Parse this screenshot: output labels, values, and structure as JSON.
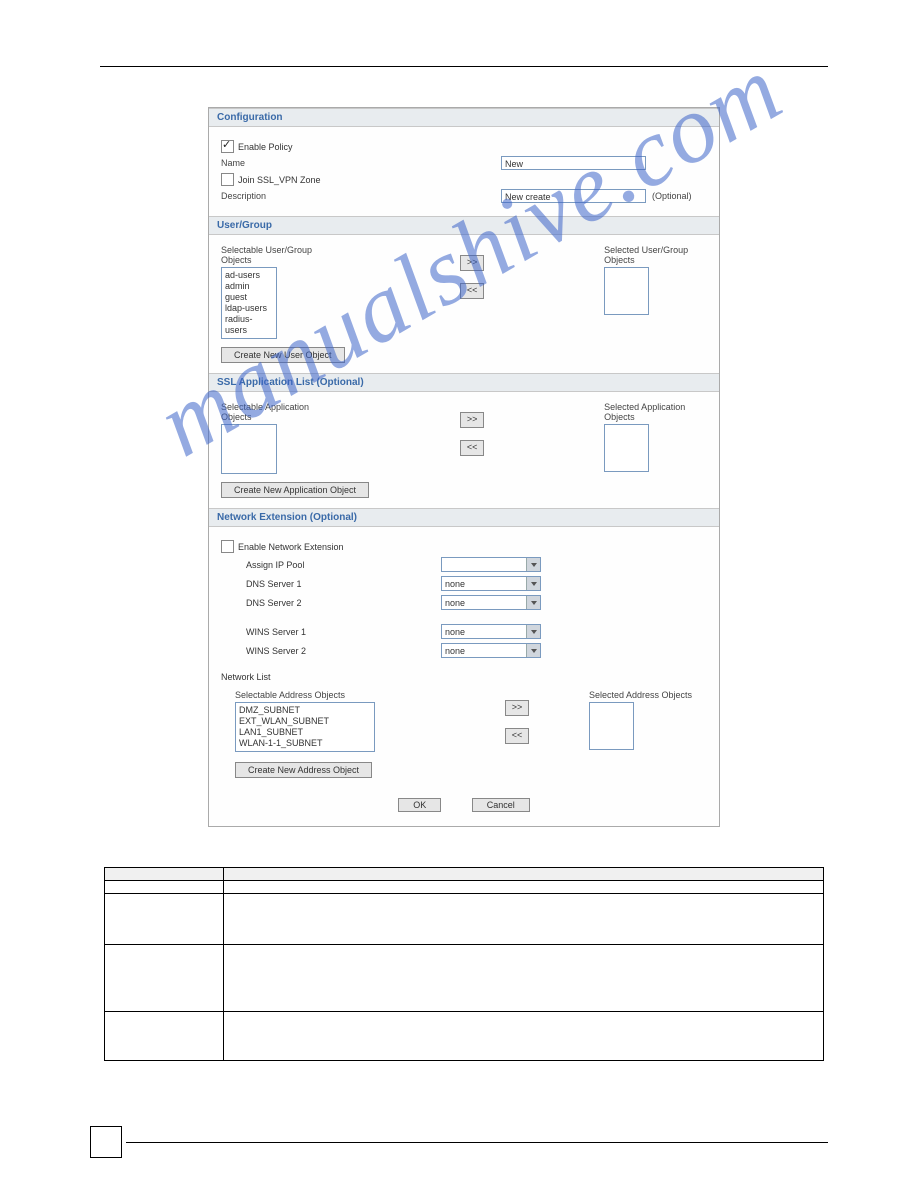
{
  "watermark": "manualshive.com",
  "screenshot": {
    "sections": {
      "configuration": {
        "title": "Configuration",
        "enable_policy_label": "Enable Policy",
        "enable_policy_checked": true,
        "name_label": "Name",
        "name_value": "New",
        "join_zone_label": "Join SSL_VPN Zone",
        "join_zone_checked": false,
        "description_label": "Description",
        "description_value": "New create",
        "optional_text": "(Optional)"
      },
      "user_group": {
        "title": "User/Group",
        "selectable_label": "Selectable User/Group Objects",
        "selected_label": "Selected User/Group Objects",
        "items": [
          "ad-users",
          "admin",
          "guest",
          "ldap-users",
          "radius-users"
        ],
        "create_btn": "Create New User Object"
      },
      "ssl_app": {
        "title": "SSL Application List (Optional)",
        "selectable_label": "Selectable Application Objects",
        "selected_label": "Selected Application Objects",
        "create_btn": "Create New Application Object"
      },
      "network_ext": {
        "title": "Network Extension (Optional)",
        "enable_label": "Enable Network Extension",
        "enable_checked": false,
        "assign_ip_label": "Assign IP Pool",
        "assign_ip_value": "",
        "dns1_label": "DNS Server 1",
        "dns1_value": "none",
        "dns2_label": "DNS Server 2",
        "dns2_value": "none",
        "wins1_label": "WINS Server 1",
        "wins1_value": "none",
        "wins2_label": "WINS Server 2",
        "wins2_value": "none",
        "network_list_label": "Network List",
        "selectable_addr_label": "Selectable Address Objects",
        "selected_addr_label": "Selected Address Objects",
        "addr_items": [
          "DMZ_SUBNET",
          "EXT_WLAN_SUBNET",
          "LAN1_SUBNET",
          "WLAN-1-1_SUBNET"
        ],
        "create_btn": "Create New Address Object"
      }
    },
    "buttons": {
      "move_right": ">>",
      "move_left": "<<",
      "ok": "OK",
      "cancel": "Cancel"
    }
  },
  "table": {
    "headers": [
      "",
      ""
    ],
    "rows": [
      {
        "label": "",
        "desc": ""
      },
      {
        "label": "",
        "desc": ""
      },
      {
        "label": "",
        "desc": ""
      },
      {
        "label": "",
        "desc": ""
      }
    ]
  }
}
